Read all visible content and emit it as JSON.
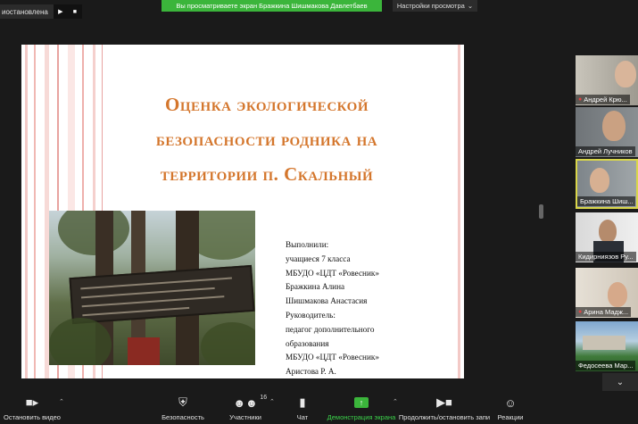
{
  "top_bar": {
    "recording_label": "иостановлена",
    "pause_icon": "pause-icon",
    "stop_icon": "stop-icon",
    "share_banner": "Вы просматриваете экран Бражкина Шишмакова Давлетбаев",
    "view_settings": "Настройки просмотра"
  },
  "slide": {
    "title_lines": [
      "Оценка экологической",
      "безопасности родника на",
      "территории п. Скальный"
    ],
    "credits": [
      "Выполнили:",
      "учащиеся 7 класса",
      "МБУДО «ЦДТ «Ровесник»",
      "Бражкина Алина",
      "Шишмакова Анастасия",
      "Руководитель:",
      "педагог дополнительного",
      "образования",
      "МБУДО «ЦДТ «Ровесник»",
      "Аристова Р. А."
    ],
    "title_color": "#d4762c",
    "stripe_color": "#e8a3a0"
  },
  "participants": [
    {
      "name": "Андрей Крю...",
      "muted": true
    },
    {
      "name": "Андрей Лучников",
      "muted": false
    },
    {
      "name": "Бражкина Шиш...",
      "muted": false,
      "active": true
    },
    {
      "name": "Кидирниязов Ру...",
      "muted": false
    },
    {
      "name": "Арина Мадж...",
      "muted": true
    },
    {
      "name": "Федосеева Мар...",
      "muted": false
    }
  ],
  "toolbar": {
    "video_label": "Остановить видео",
    "security_label": "Безопасность",
    "participants_label": "Участники",
    "participants_count": "16",
    "chat_label": "Чат",
    "share_label": "Демонстрация экрана",
    "record_label": "Продолжить/остановить запи",
    "reactions_label": "Реакции"
  },
  "colors": {
    "share_green": "#3bb53b",
    "active_border": "#d9d64a"
  }
}
